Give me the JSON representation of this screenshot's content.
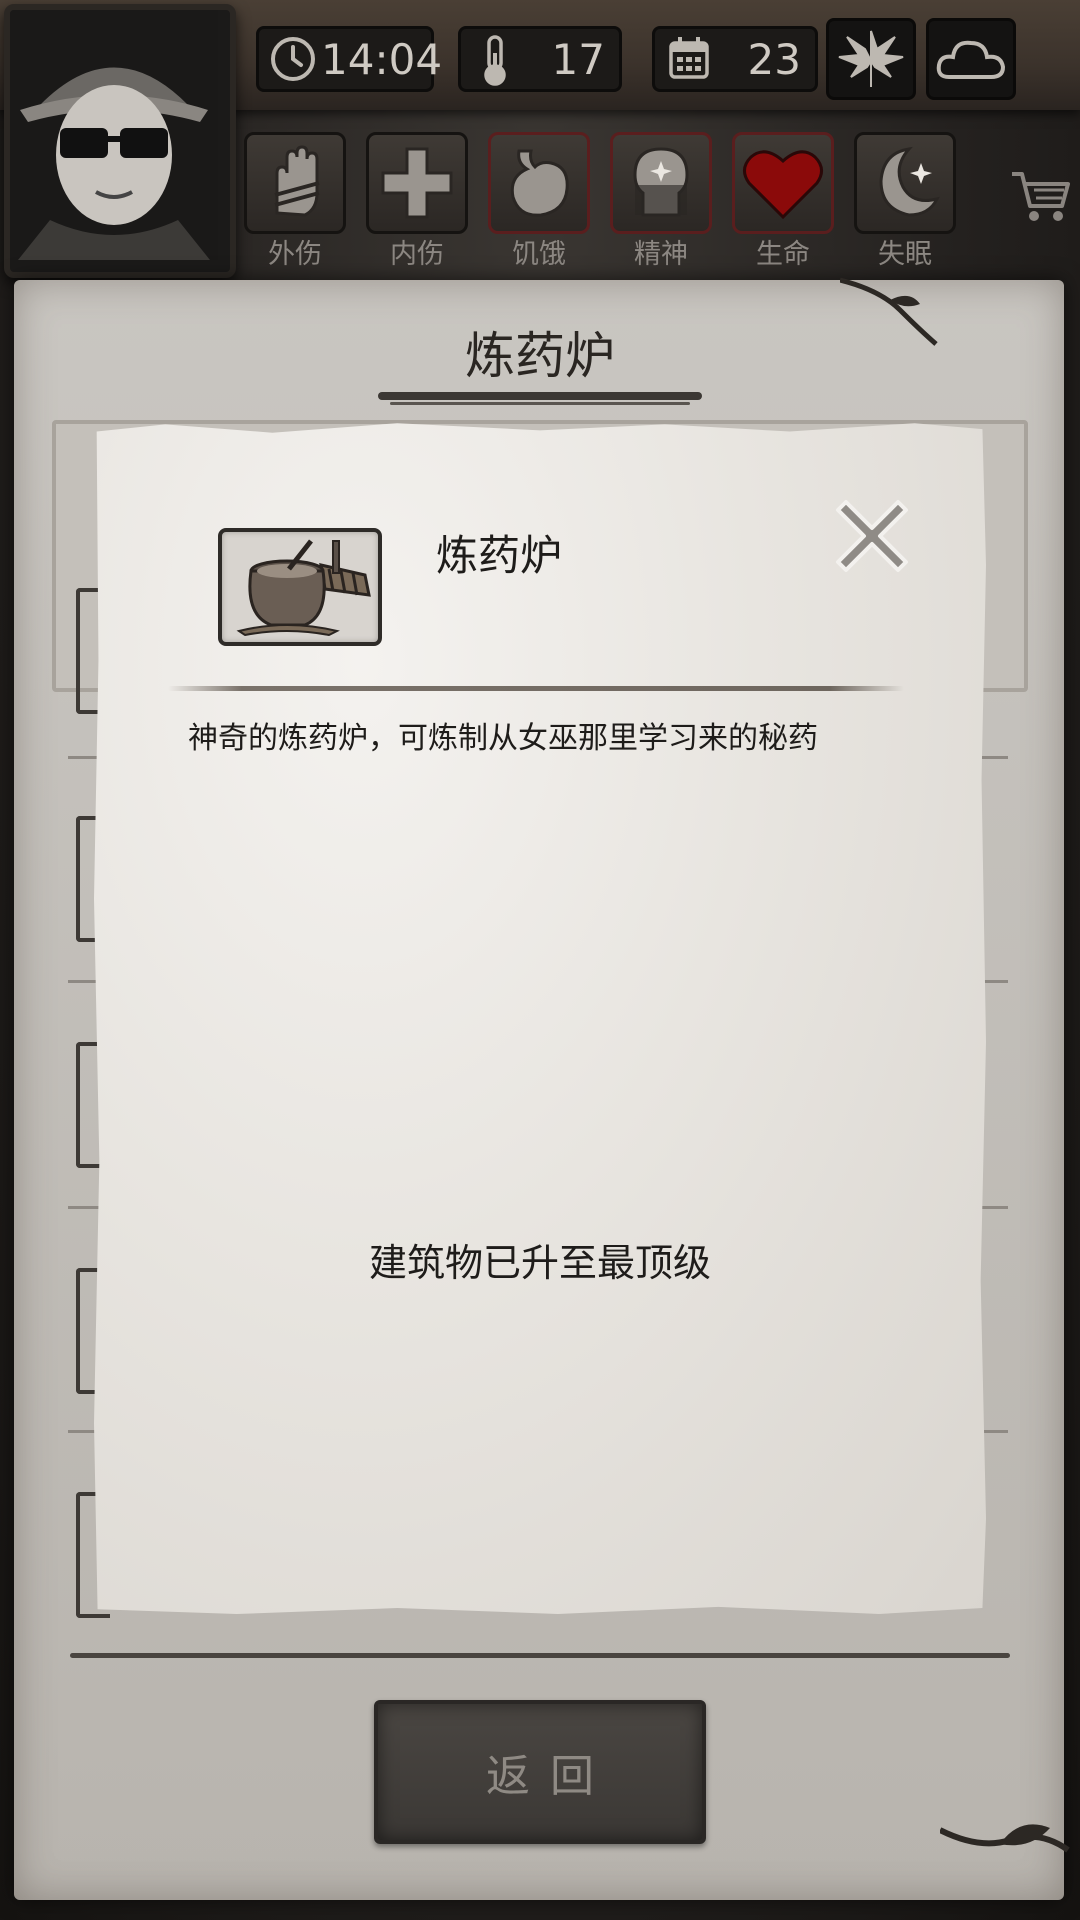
{
  "hud": {
    "time": "14:04",
    "temperature": "17",
    "day": "23",
    "season_icon": "leaf-icon",
    "weather_icon": "cloud-icon"
  },
  "status_bar": [
    {
      "label": "外伤",
      "icon": "hand-icon"
    },
    {
      "label": "内伤",
      "icon": "cross-icon"
    },
    {
      "label": "饥饿",
      "icon": "stomach-icon"
    },
    {
      "label": "精神",
      "icon": "head-icon"
    },
    {
      "label": "生命",
      "icon": "heart-icon"
    },
    {
      "label": "失眠",
      "icon": "moon-star-icon"
    }
  ],
  "background_panel": {
    "title": "炼药炉"
  },
  "modal": {
    "item_name": "炼药炉",
    "description": "神奇的炼药炉，可炼制从女巫那里学习来的秘药",
    "status": "建筑物已升至最顶级"
  },
  "back_button": {
    "label": "返回"
  },
  "colors": {
    "heart": "#8b0a0a",
    "paper": "#e8e5e0",
    "panel": "#c9c6c1",
    "hud_dark": "#1c1a18"
  }
}
